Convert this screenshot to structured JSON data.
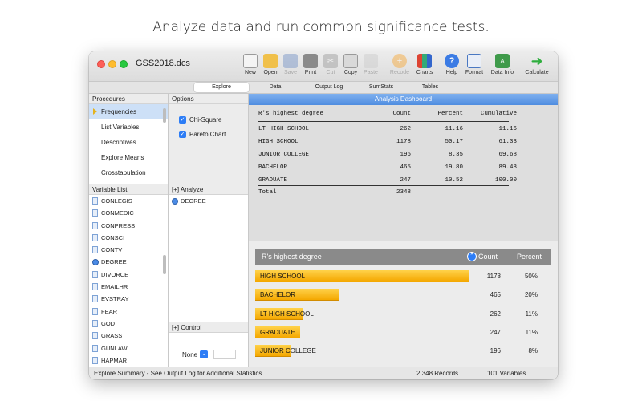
{
  "headline": "Analyze data and run common significance tests.",
  "window": {
    "title": "GSS2018.dcs"
  },
  "toolbar": {
    "new": "New",
    "open": "Open",
    "save": "Save",
    "print": "Print",
    "cut": "Cut",
    "copy": "Copy",
    "paste": "Paste",
    "recode": "Recode",
    "charts": "Charts",
    "help": "Help",
    "format": "Format",
    "data_info": "Data Info",
    "calculate": "Calculate"
  },
  "tabs": [
    "Explore",
    "Data",
    "Output Log",
    "SumStats",
    "Tables"
  ],
  "procedures": {
    "header": "Procedures",
    "items": [
      "Frequencies",
      "List Variables",
      "Descriptives",
      "Explore Means",
      "Crosstabulation"
    ]
  },
  "options": {
    "header": "Options",
    "chi_square": "Chi-Square",
    "pareto": "Pareto Chart"
  },
  "variables": {
    "header": "Variable List",
    "items": [
      "CONLEGIS",
      "CONMEDIC",
      "CONPRESS",
      "CONSCI",
      "CONTV",
      "DEGREE",
      "DIVORCE",
      "EMAILHR",
      "EVSTRAY",
      "FEAR",
      "GOD",
      "GRASS",
      "GUNLAW",
      "HAPMAR"
    ]
  },
  "analyze": {
    "header": "[+] Analyze",
    "items": [
      "DEGREE"
    ]
  },
  "control": {
    "header": "[+] Control",
    "select_value": "None"
  },
  "dashboard": {
    "title": "Analysis Dashboard",
    "table": {
      "headers": [
        "R's highest degree",
        "Count",
        "Percent",
        "Cumulative"
      ],
      "rows": [
        [
          "LT HIGH SCHOOL",
          "262",
          "11.16",
          "11.16"
        ],
        [
          "HIGH SCHOOL",
          "1178",
          "50.17",
          "61.33"
        ],
        [
          "JUNIOR COLLEGE",
          "196",
          "8.35",
          "69.68"
        ],
        [
          "BACHELOR",
          "465",
          "19.80",
          "89.48"
        ],
        [
          "GRADUATE",
          "247",
          "10.52",
          "100.00"
        ]
      ],
      "total_label": "Total",
      "total_count": "2348"
    },
    "chart": {
      "header_label": "R's highest degree",
      "count_label": "Count",
      "percent_label": "Percent",
      "rows": [
        {
          "label": "HIGH SCHOOL",
          "count": "1178",
          "percent": "50%",
          "value": 1178
        },
        {
          "label": "BACHELOR",
          "count": "465",
          "percent": "20%",
          "value": 465
        },
        {
          "label": "LT HIGH SCHOOL",
          "count": "262",
          "percent": "11%",
          "value": 262
        },
        {
          "label": "GRADUATE",
          "count": "247",
          "percent": "11%",
          "value": 247
        },
        {
          "label": "JUNIOR COLLEGE",
          "count": "196",
          "percent": "8%",
          "value": 196
        }
      ]
    }
  },
  "status": {
    "summary": "Explore Summary  -  See Output Log for Additional Statistics",
    "records": "2,348 Records",
    "variables": "101 Variables"
  }
}
